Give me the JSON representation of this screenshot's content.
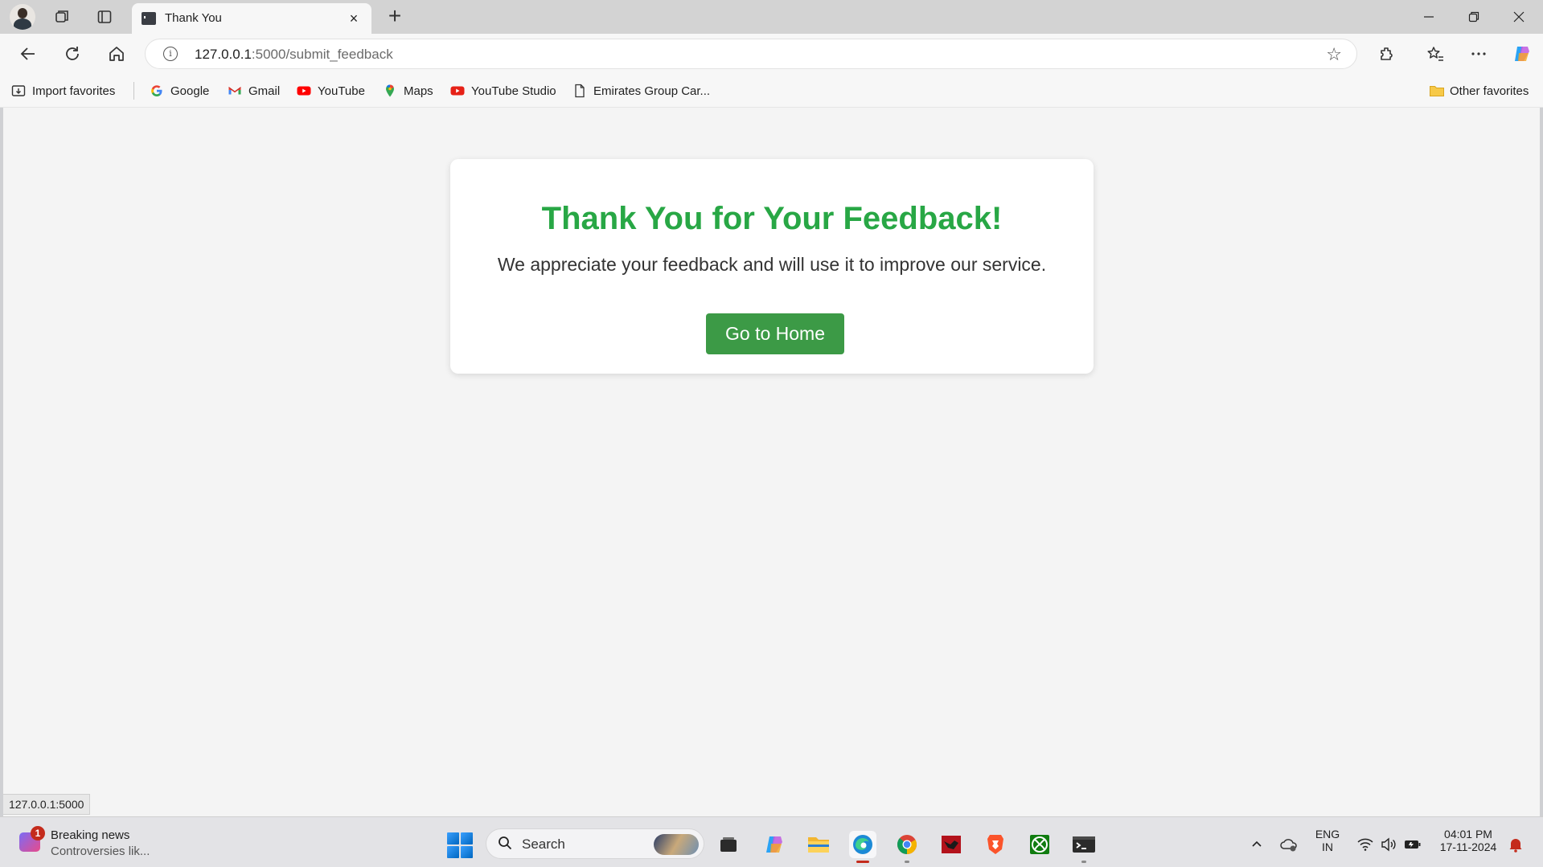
{
  "browser": {
    "tab_title": "Thank You",
    "url_host": "127.0.0.1",
    "url_path": ":5000/submit_feedback",
    "new_tab_symbol": "+",
    "close_tab_symbol": "×"
  },
  "bookmarks": [
    {
      "label": "Import favorites",
      "icon": "import-icon"
    },
    {
      "label": "Google",
      "icon": "google-icon"
    },
    {
      "label": "Gmail",
      "icon": "gmail-icon"
    },
    {
      "label": "YouTube",
      "icon": "youtube-icon"
    },
    {
      "label": "Maps",
      "icon": "maps-icon"
    },
    {
      "label": "YouTube Studio",
      "icon": "youtube-studio-icon"
    },
    {
      "label": "Emirates Group Car...",
      "icon": "document-icon"
    }
  ],
  "other_favorites": "Other favorites",
  "page": {
    "heading": "Thank You for Your Feedback!",
    "message": "We appreciate your feedback and will use it to improve our service.",
    "button_label": "Go to Home",
    "accent_color": "#28a745",
    "button_color": "#3c9a46"
  },
  "status_bar": "127.0.0.1:5000",
  "taskbar": {
    "news_badge": "1",
    "news_title": "Breaking news",
    "news_subtitle": "Controversies lik...",
    "search_label": "Search",
    "language_line1": "ENG",
    "language_line2": "IN",
    "time": "04:01 PM",
    "date": "17-11-2024",
    "apps": [
      "task-view-icon",
      "copilot-icon",
      "file-explorer-icon",
      "edge-icon",
      "chrome-icon",
      "app-icon",
      "brave-icon",
      "xbox-icon",
      "terminal-icon"
    ]
  }
}
